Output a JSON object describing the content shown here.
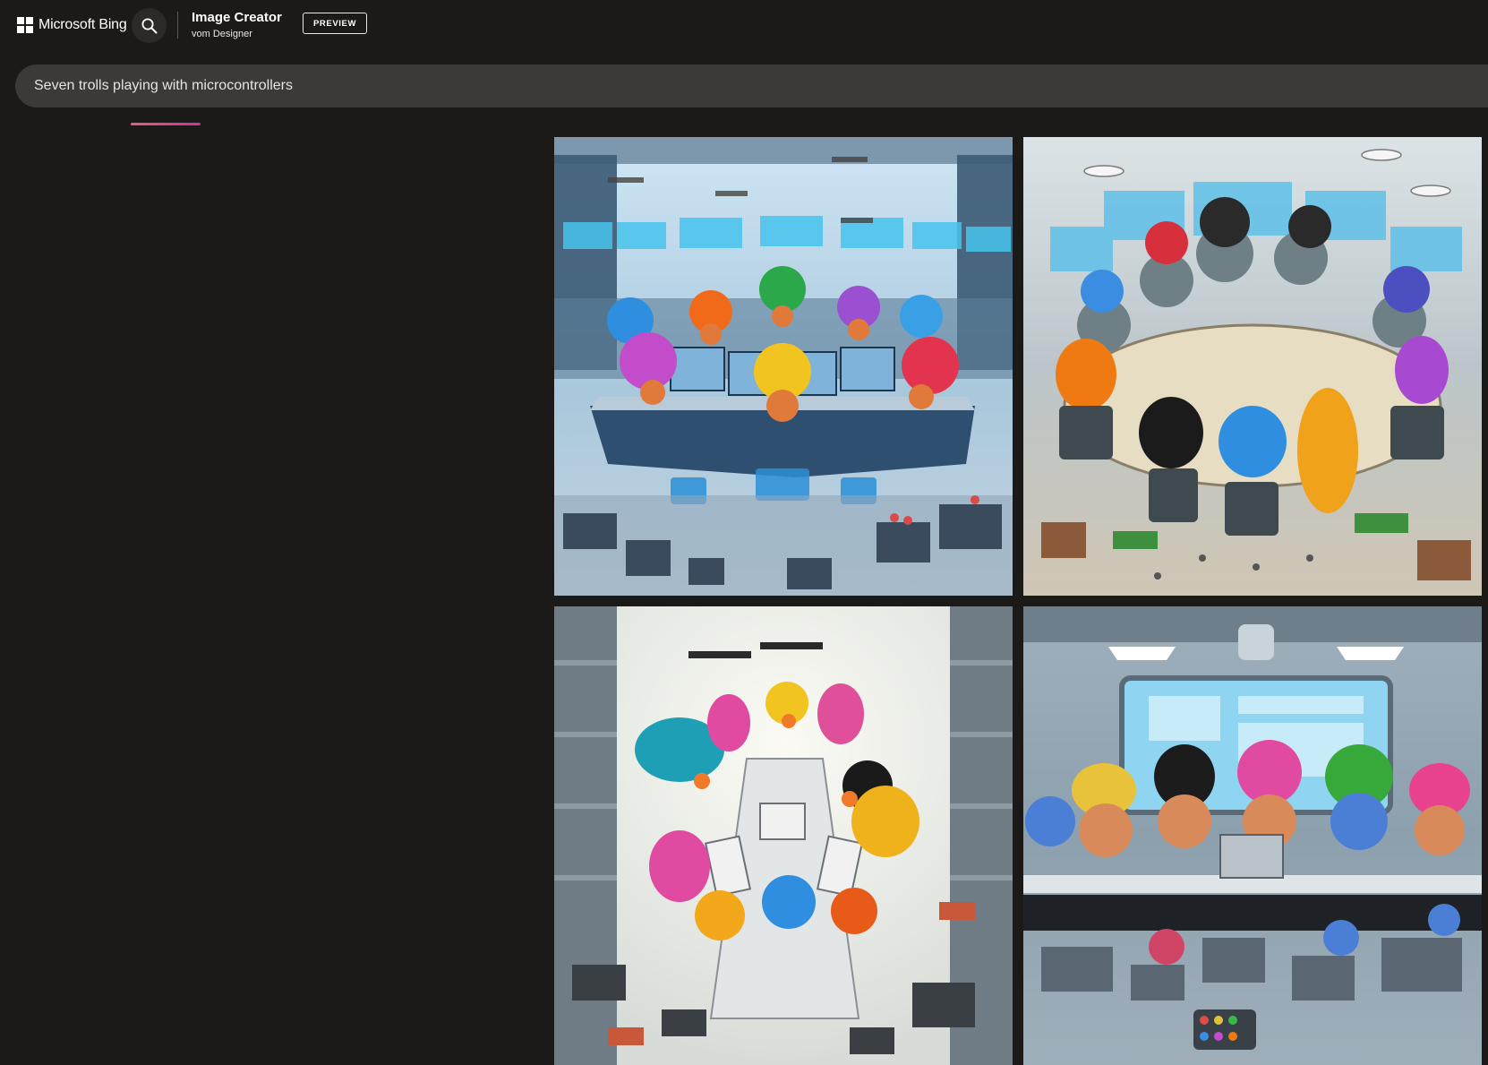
{
  "header": {
    "brand_name": "Microsoft Bing",
    "product_title": "Image Creator",
    "product_subtitle": "vom Designer",
    "badge": "PREVIEW"
  },
  "prompt": {
    "value": "Seven trolls playing with microcontrollers"
  },
  "icons": {
    "logo": "microsoft-logo-icon",
    "search": "search-icon"
  },
  "colors": {
    "background": "#1b1a19",
    "prompt_bar": "#3b3a39",
    "accent_start": "#e0607e",
    "accent_end": "#c9358f"
  },
  "results": [
    {
      "id": "tile1",
      "scene": "lab-computers",
      "troll_hair": [
        "#2f8ee0",
        "#f06a1a",
        "#2aa84a",
        "#9b4fd1",
        "#3aa0e6",
        "#c24cc9",
        "#f2c420",
        "#e2334f"
      ]
    },
    {
      "id": "tile2",
      "scene": "round-table",
      "troll_hair": [
        "#d6303d",
        "#2a2a2a",
        "#2a2a2a",
        "#3a8de0",
        "#4b4fbf",
        "#f07a12",
        "#1b1b1b",
        "#2f8ee0",
        "#f0a21a",
        "#a84ad1"
      ]
    },
    {
      "id": "tile3",
      "scene": "white-lab-tablets",
      "troll_hair": [
        "#1e9fb5",
        "#e04aa0",
        "#f2c420",
        "#e0509a",
        "#1a1a1a",
        "#e04aa0",
        "#f0b21a",
        "#f2a81a",
        "#2f8ee0",
        "#e85a18"
      ]
    },
    {
      "id": "tile4",
      "scene": "control-room",
      "troll_hair": [
        "#e8c23a",
        "#1c1c1c",
        "#e04aa0",
        "#37a83a",
        "#e8428e"
      ]
    }
  ]
}
